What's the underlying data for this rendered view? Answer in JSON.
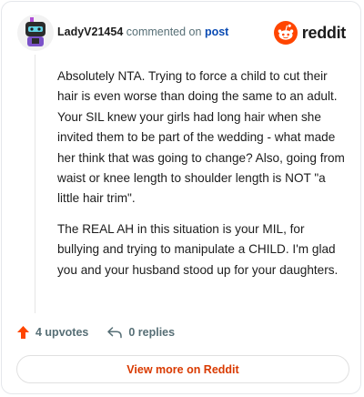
{
  "header": {
    "username": "LadyV21454",
    "action_text": "commented on",
    "post_link": "post",
    "brand": "reddit"
  },
  "comment": {
    "paragraphs": [
      "Absolutely NTA. Trying to force a child to cut their hair is even worse than doing the same to an adult. Your SIL knew your girls had long hair when she invited them to be part of the wedding - what made her think that was going to change? Also, going from waist or knee length to shoulder length is NOT \"a little hair trim\".",
      "The REAL AH in this situation is your MIL, for bullying and trying to manipulate a CHILD. I'm glad you and your husband stood up for your daughters."
    ]
  },
  "actions": {
    "upvotes": "4 upvotes",
    "replies": "0 replies"
  },
  "view_more": "View more on Reddit",
  "colors": {
    "reddit_orange": "#ff4500",
    "link_blue": "#0a4bb3",
    "button_text": "#d93a00"
  }
}
